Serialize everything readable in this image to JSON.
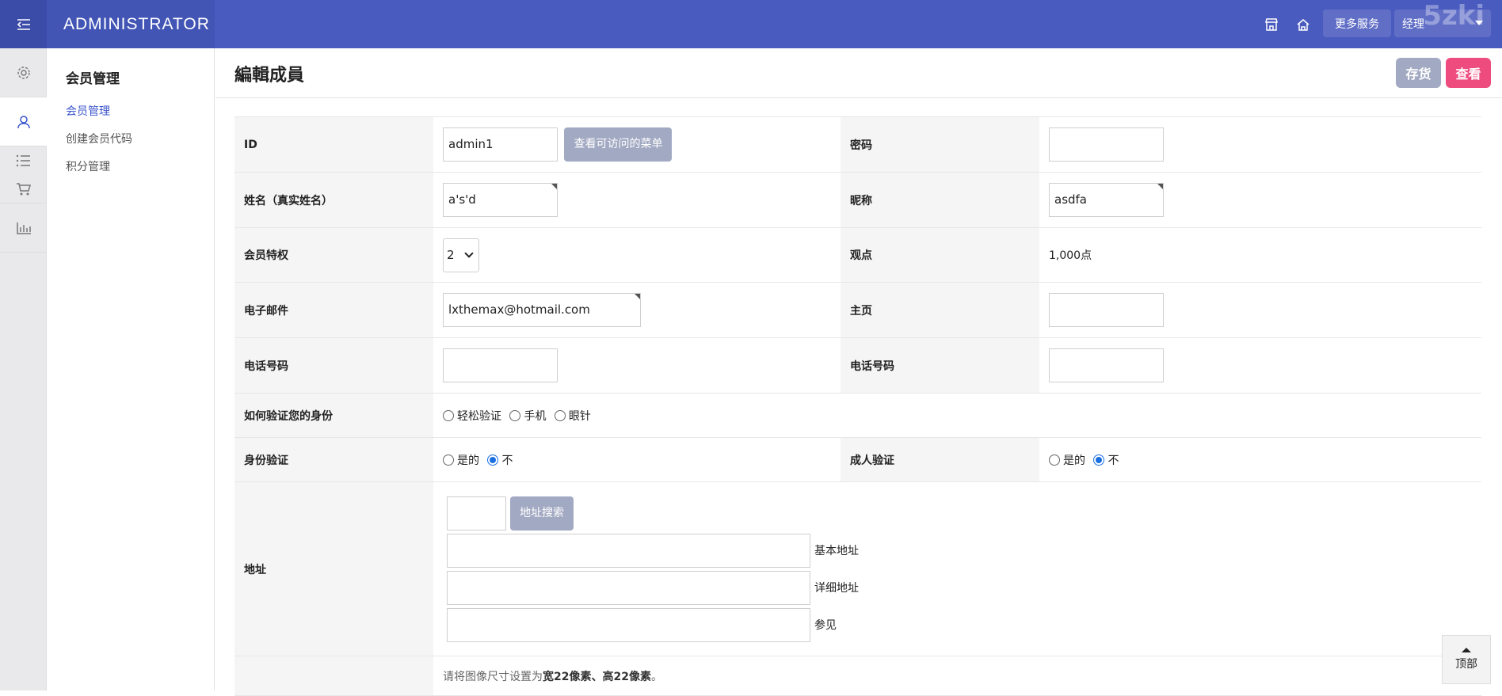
{
  "header": {
    "brand": "ADMINISTRATOR",
    "more_services": "更多服务",
    "user": "经理",
    "logo": "5zki"
  },
  "rail": {
    "icons": [
      "gear-icon",
      "user-icon",
      "list-icon",
      "cart-icon",
      "chart-icon"
    ]
  },
  "submenu": {
    "title": "会员管理",
    "items": [
      {
        "label": "会员管理",
        "active": true
      },
      {
        "label": "创建会员代码",
        "active": false
      },
      {
        "label": "积分管理",
        "active": false
      }
    ]
  },
  "page": {
    "title": "編輯成員",
    "save_label": "存货",
    "view_label": "查看"
  },
  "form": {
    "id_label": "ID",
    "id_value": "admin1",
    "id_button": "查看可访问的菜单",
    "password_label": "密码",
    "name_label": "姓名（真实姓名）",
    "name_value": "a's'd",
    "nickname_label": "昵称",
    "nickname_value": "asdfa",
    "privilege_label": "会员特权",
    "privilege_value": "2",
    "points_label": "观点",
    "points_value": "1,000点",
    "email_label": "电子邮件",
    "email_value": "lxthemax@hotmail.com",
    "homepage_label": "主页",
    "phone_label": "电话号码",
    "phone2_label": "电话号码",
    "verify_label": "如何验证您的身份",
    "verify_options": [
      "轻松验证",
      "手机",
      "眼针"
    ],
    "identity_label": "身份验证",
    "identity_yes": "是的",
    "identity_no": "不",
    "adult_label": "成人验证",
    "adult_yes": "是的",
    "adult_no": "不",
    "address_label": "地址",
    "address_search": "地址搜索",
    "address_basic": "基本地址",
    "address_detail": "详细地址",
    "address_ref": "参见",
    "image_hint_pre": "请将图像尺寸设置为",
    "image_hint_bold": "宽22像素、高22像素",
    "image_hint_post": "。"
  },
  "top_button": "顶部"
}
